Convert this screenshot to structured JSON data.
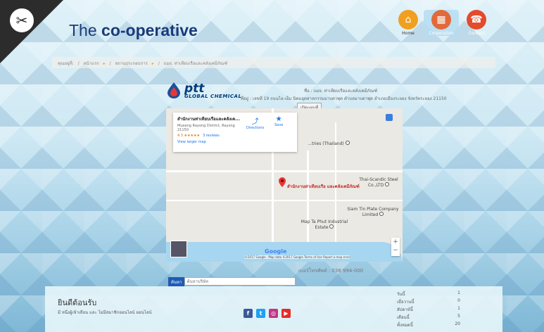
{
  "brand": {
    "prefix": "The ",
    "name": "co-operative"
  },
  "nav": [
    {
      "label": "Home",
      "icon": "home-icon",
      "color": "#f0a020"
    },
    {
      "label": "Corporation",
      "icon": "building-icon",
      "color": "#e26a3a"
    },
    {
      "label": "Contact",
      "icon": "phone-book-icon",
      "color": "#e34b2d"
    }
  ],
  "breadcrumb": {
    "prefix": "คุณอยู่ที่:",
    "items": [
      "หน้าแรก",
      "สถานประกอบการ",
      "บมจ. ท่าเทียบเรือและคลังเคมีภัณฑ์"
    ]
  },
  "company": {
    "logo_word": "ptt",
    "logo_sub": "GLOBAL CHEMICAL",
    "name_line": "ชื่อ : บมจ. ท่าเทียบเรือและคลังเคมีภัณฑ์",
    "address_line": "ที่อยู่ : เลขที่ 19 ถนนไอ-เอ็ม นิคมอุตสาหกรรมมาบตาพุด ตำบลมาบตาพุด อำเภอเมืองระยอง จังหวัดระยอง 21150",
    "hours_button": "เปิดแผนที่"
  },
  "map": {
    "card_title": "สำนักงานท่าเทียบเรือและคลังเค...",
    "card_address": "Mueang Rayong District, Rayong 21150",
    "rating": "4.3 ★★★★★",
    "reviews": "3 reviews",
    "larger_map": "View larger map",
    "directions": "Directions",
    "save": "Save",
    "pin_label": "สำนักงานท่าเทียบเรือ และคลังเคมีภัณฑ์",
    "places": [
      "...tries (Thailand)",
      "Thai-Scandic Steel Co.,LTD",
      "Siam Tin Plate Company Limited",
      "Map Ta Phut Industrial Estate"
    ],
    "google": "Google",
    "copyright": "©2017 Google · Map data ©2017 Google   Terms of Use   Report a map error"
  },
  "phone": "เบอร์โทรศัพท์ : 038 994-000",
  "search": {
    "button": "ค้นหา",
    "placeholder": "ค้นหาบริษัท"
  },
  "footer": {
    "welcome": "ยินดีต้อนรับ",
    "slogan": "มี หนึ่งผู้เข้าเยือน และ ไม่มีสมาชิกออนไลน์ ออนไลน์",
    "stats": [
      {
        "k": "วันนี้",
        "v": "1"
      },
      {
        "k": "เมื่อวานนี้",
        "v": "0"
      },
      {
        "k": "สัปดาห์นี้",
        "v": "1"
      },
      {
        "k": "เดือนนี้",
        "v": "5"
      },
      {
        "k": "ทั้งหมดนี้",
        "v": "20"
      }
    ]
  },
  "social": [
    {
      "icon": "facebook-icon",
      "glyph": "f",
      "color": "#3b5998"
    },
    {
      "icon": "twitter-icon",
      "glyph": "t",
      "color": "#1da1f2"
    },
    {
      "icon": "instagram-icon",
      "glyph": "◎",
      "color": "#c13584"
    },
    {
      "icon": "youtube-icon",
      "glyph": "▶",
      "color": "#e52d27"
    }
  ]
}
